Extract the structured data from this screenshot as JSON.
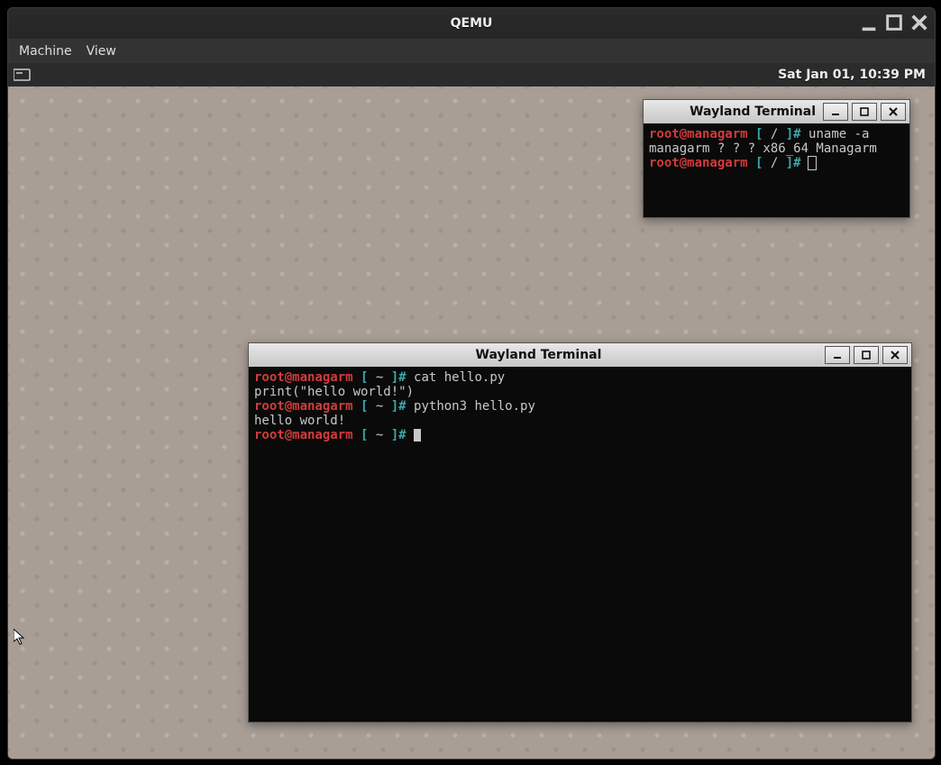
{
  "qemu": {
    "title": "QEMU",
    "menubar": {
      "machine": "Machine",
      "view": "View"
    }
  },
  "panel": {
    "clock": "Sat Jan 01, 10:39 PM"
  },
  "term_small": {
    "title": "Wayland Terminal",
    "l1_user": "root@managarm",
    "l1_br_open": " [ ",
    "l1_cwd": "/",
    "l1_br_close": " ]# ",
    "l1_cmd": "uname -a",
    "l2_out": "managarm ? ? ? x86_64 Managarm",
    "l3_user": "root@managarm",
    "l3_br_open": " [ ",
    "l3_cwd": "/",
    "l3_br_close": " ]# "
  },
  "term_big": {
    "title": "Wayland Terminal",
    "l1_user": "root@managarm",
    "l1_br_open": " [ ",
    "l1_cwd": "~",
    "l1_br_close": " ]# ",
    "l1_cmd": "cat hello.py",
    "l2_out": "print(\"hello world!\")",
    "l3_user": "root@managarm",
    "l3_br_open": " [ ",
    "l3_cwd": "~",
    "l3_br_close": " ]# ",
    "l3_cmd": "python3 hello.py",
    "l4_out": "hello world!",
    "l5_user": "root@managarm",
    "l5_br_open": " [ ",
    "l5_cwd": "~",
    "l5_br_close": " ]# "
  }
}
